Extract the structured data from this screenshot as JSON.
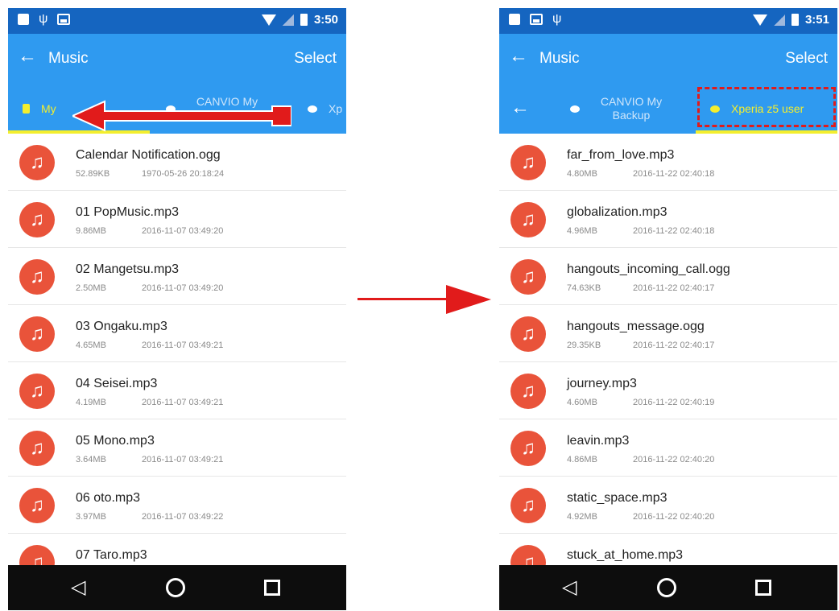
{
  "left_phone": {
    "status": {
      "time": "3:50"
    },
    "app_bar": {
      "back": "←",
      "title": "Music",
      "select": "Select"
    },
    "tabs": [
      {
        "label": "My",
        "active": true
      },
      {
        "label": "CANVIO My Backup",
        "active": false
      },
      {
        "label": "Xp",
        "active": false
      }
    ],
    "files": [
      {
        "name": "Calendar Notification.ogg",
        "size": "52.89KB",
        "date": "1970-05-26 20:18:24"
      },
      {
        "name": "01 PopMusic.mp3",
        "size": "9.86MB",
        "date": "2016-11-07 03:49:20"
      },
      {
        "name": "02 Mangetsu.mp3",
        "size": "2.50MB",
        "date": "2016-11-07 03:49:20"
      },
      {
        "name": "03 Ongaku.mp3",
        "size": "4.65MB",
        "date": "2016-11-07 03:49:21"
      },
      {
        "name": "04 Seisei.mp3",
        "size": "4.19MB",
        "date": "2016-11-07 03:49:21"
      },
      {
        "name": "05 Mono.mp3",
        "size": "3.64MB",
        "date": "2016-11-07 03:49:21"
      },
      {
        "name": "06 oto.mp3",
        "size": "3.97MB",
        "date": "2016-11-07 03:49:22"
      },
      {
        "name": "07 Taro.mp3",
        "size": "",
        "date": ""
      }
    ]
  },
  "right_phone": {
    "status": {
      "time": "3:51"
    },
    "app_bar": {
      "back": "←",
      "title": "Music",
      "select": "Select"
    },
    "tab_back": "←",
    "tabs": [
      {
        "label": "CANVIO My Backup",
        "active": false
      },
      {
        "label": "Xperia z5 user",
        "active": true
      }
    ],
    "files": [
      {
        "name": "far_from_love.mp3",
        "size": "4.80MB",
        "date": "2016-11-22 02:40:18"
      },
      {
        "name": "globalization.mp3",
        "size": "4.96MB",
        "date": "2016-11-22 02:40:18"
      },
      {
        "name": "hangouts_incoming_call.ogg",
        "size": "74.63KB",
        "date": "2016-11-22 02:40:17"
      },
      {
        "name": "hangouts_message.ogg",
        "size": "29.35KB",
        "date": "2016-11-22 02:40:17"
      },
      {
        "name": "journey.mp3",
        "size": "4.60MB",
        "date": "2016-11-22 02:40:19"
      },
      {
        "name": "leavin.mp3",
        "size": "4.86MB",
        "date": "2016-11-22 02:40:20"
      },
      {
        "name": "static_space.mp3",
        "size": "4.92MB",
        "date": "2016-11-22 02:40:20"
      },
      {
        "name": "stuck_at_home.mp3",
        "size": "",
        "date": ""
      }
    ]
  },
  "icons": {
    "music_note": "♫",
    "nav_back": "◁",
    "annotation_color": "#e11b1b"
  }
}
